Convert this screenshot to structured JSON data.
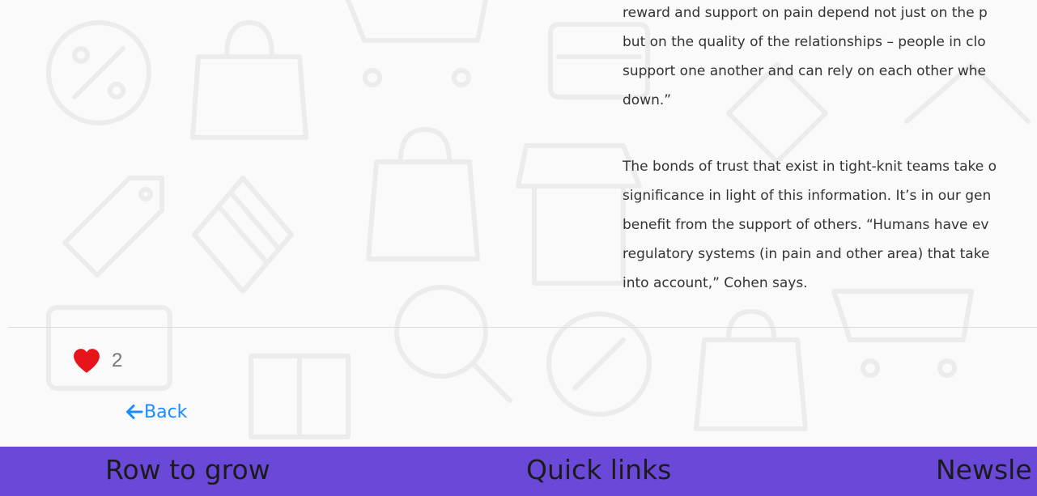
{
  "article": {
    "paragraphs": [
      {
        "lines": [
          "reward and support on pain depend not just on the p",
          "but on the quality of the relationships – people in clo",
          "support one another and can rely on each other whe",
          "down.”"
        ]
      },
      {
        "lines": [
          "The bonds of trust that exist in tight-knit teams take o",
          "significance in light of this information. It’s in our gen",
          "benefit from the support of others. “Humans have ev",
          "regulatory systems (in pain and other area) that take",
          "into account,” Cohen says."
        ]
      }
    ]
  },
  "likes": {
    "count": "2",
    "icon": "heart-icon",
    "color": "#e8141b"
  },
  "back": {
    "label": "Back",
    "icon": "arrow-left-icon",
    "color": "#1a8cff"
  },
  "footer": {
    "background": "#6b49d8",
    "headings": [
      "Row to grow",
      "Quick links",
      "Newsle"
    ]
  }
}
